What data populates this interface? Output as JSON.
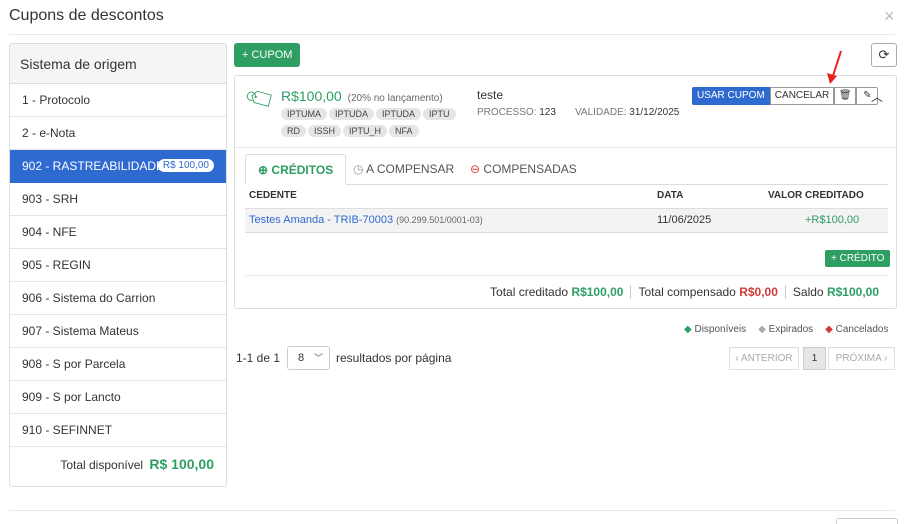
{
  "modal": {
    "title": "Cupons de descontos",
    "close_glyph": "×"
  },
  "sidebar": {
    "header": "Sistema de origem",
    "items": [
      {
        "label": "1 - Protocolo"
      },
      {
        "label": "2 - e-Nota"
      },
      {
        "label": "902 - RASTREABILIDADE",
        "badge": "R$ 100,00",
        "active": true
      },
      {
        "label": "903 - SRH"
      },
      {
        "label": "904 - NFE"
      },
      {
        "label": "905 - REGIN"
      },
      {
        "label": "906 - Sistema do Carrion"
      },
      {
        "label": "907 - Sistema Mateus"
      },
      {
        "label": "908 - S por Parcela"
      },
      {
        "label": "909 - S por Lancto"
      },
      {
        "label": "910 - SEFINNET"
      }
    ],
    "total_label": "Total disponível",
    "total_value": "R$ 100,00"
  },
  "toolbar": {
    "add_label": "+ CUPOM",
    "refresh_icon": "refresh-icon"
  },
  "coupon": {
    "amount": "R$100,00",
    "note": "(20% no lançamento)",
    "name": "teste",
    "tags": [
      "IPTUMA",
      "IPTUDA",
      "IPTUDA",
      "IPTU",
      "RD",
      "ISSH",
      "IPTU_H",
      "NFA"
    ],
    "processo_label": "PROCESSO:",
    "processo_value": "123",
    "validade_label": "VALIDADE:",
    "validade_value": "31/12/2025",
    "use_label": "USAR CUPOM",
    "cancel_label": "CANCELAR",
    "delete_icon": "trash-icon",
    "edit_icon": "pencil-icon",
    "collapse_icon": "chevron-up-icon",
    "tabs": [
      {
        "label": "CRÉDITOS",
        "icon": "plus-circle-icon",
        "active": true
      },
      {
        "label": "A COMPENSAR",
        "icon": "clock-icon"
      },
      {
        "label": "COMPENSADAS",
        "icon": "minus-circle-icon"
      }
    ],
    "table": {
      "headers": [
        "CEDENTE",
        "DATA",
        "VALOR CREDITADO"
      ],
      "rows": [
        {
          "cedente": "Testes Amanda - TRIB-70003",
          "doc": "(90.299.501/0001-03)",
          "data": "11/06/2025",
          "valor": "+R$100,00"
        }
      ]
    },
    "add_credit_label": "+ CRÉDITO",
    "totals": {
      "creditado_label": "Total creditado",
      "creditado_value": "R$100,00",
      "compensado_label": "Total compensado",
      "compensado_value": "R$0,00",
      "saldo_label": "Saldo",
      "saldo_value": "R$100,00"
    }
  },
  "legend": {
    "disponiveis": "Disponíveis",
    "expirados": "Expirados",
    "cancelados": "Cancelados"
  },
  "pagination": {
    "range": "1-1 de 1",
    "per_page": "8",
    "per_page_label": "resultados por página",
    "prev_label": "‹ ANTERIOR",
    "page": "1",
    "next_label": "PRÓXIMA ›"
  },
  "colors": {
    "green": "#2e9e63",
    "blue": "#2f6ad0",
    "red": "#e03c3c"
  }
}
